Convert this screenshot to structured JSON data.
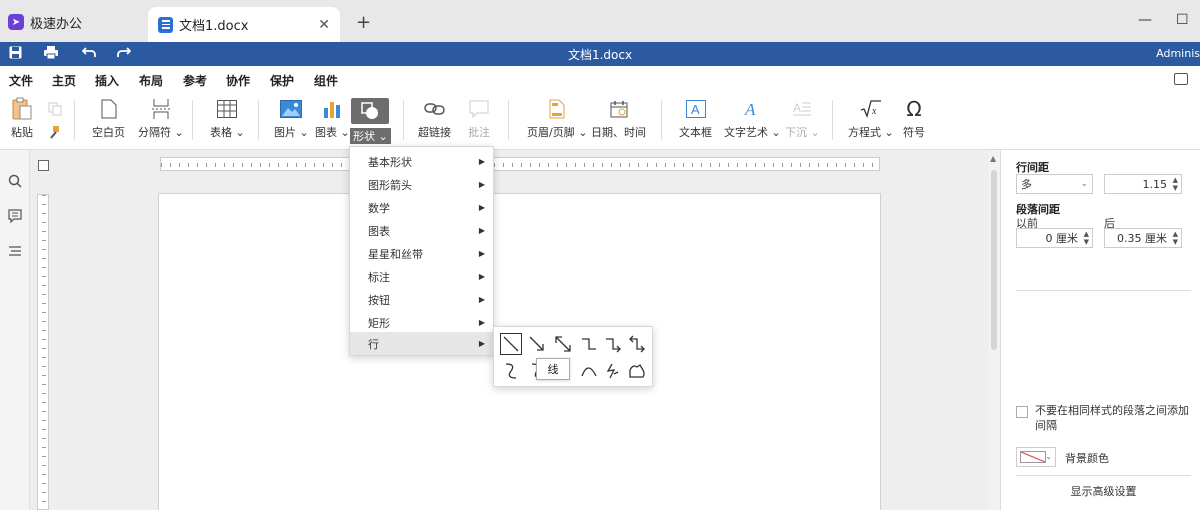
{
  "app": {
    "name": "极速办公"
  },
  "tab": {
    "label": "文档1.docx",
    "close": "✕",
    "new_tab": "+"
  },
  "window": {
    "minimize": "—",
    "maximize": "☐"
  },
  "titlebar": {
    "title": "文档1.docx",
    "user": "Adminis"
  },
  "menu": {
    "items": [
      "文件",
      "主页",
      "插入",
      "布局",
      "参考",
      "协作",
      "保护",
      "组件"
    ],
    "active": "插入"
  },
  "ribbon": {
    "paste": "粘贴",
    "blank_page": "空白页",
    "break": "分隔符",
    "table": "表格",
    "picture": "图片",
    "chart": "图表",
    "shape": "形状",
    "hyperlink": "超链接",
    "comment": "批注",
    "header_footer": "页眉/页脚",
    "datetime": "日期、时间",
    "textbox": "文本框",
    "textart": "文字艺术",
    "dropcap": "下沉",
    "equation": "方程式",
    "symbol": "符号"
  },
  "shape_menu": {
    "items": [
      "基本形状",
      "图形箭头",
      "数学",
      "图表",
      "星星和丝带",
      "标注",
      "按钮",
      "矩形",
      "行"
    ],
    "hovered": "行"
  },
  "line_submenu": {
    "tooltip": "线"
  },
  "right_panel": {
    "line_spacing_label": "行间距",
    "line_spacing_mode": "多",
    "line_spacing_value": "1.15",
    "para_spacing_label": "段落间距",
    "before_label": "以前",
    "after_label": "后",
    "before_value": "0 厘米",
    "after_value": "0.35 厘米",
    "no_space_same_style": "不要在相同样式的段落之间添加间隔",
    "background_color": "背景颜色",
    "advanced_settings": "显示高级设置"
  }
}
